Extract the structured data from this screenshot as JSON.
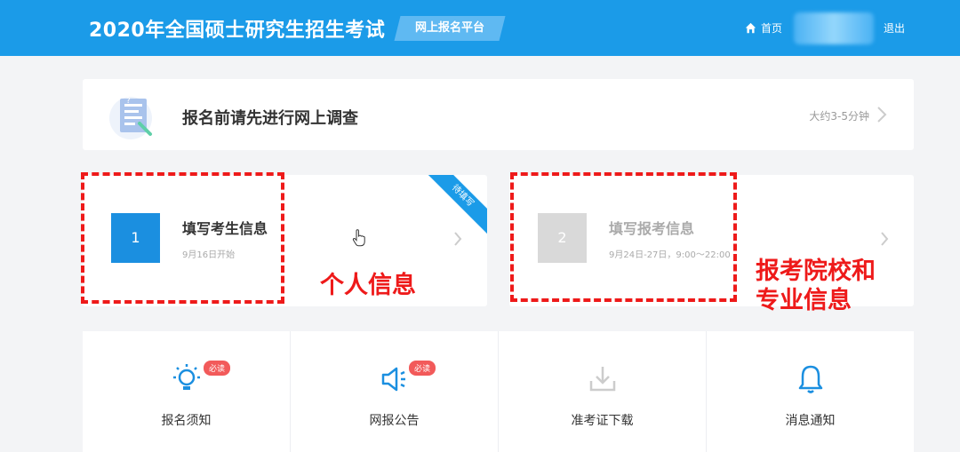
{
  "header": {
    "title": "2020年全国硕士研究生招生考试",
    "platform": "网上报名平台",
    "home": "首页",
    "logout": "退出"
  },
  "survey": {
    "title": "报名前请先进行网上调查",
    "time": "大约3-5分钟"
  },
  "steps": [
    {
      "number": "1",
      "title": "填写考生信息",
      "date": "9月16日开始",
      "ribbon": "待填写"
    },
    {
      "number": "2",
      "title": "填写报考信息",
      "date": "9月24日-27日，9:00～22:00"
    }
  ],
  "annotations": {
    "personal": "个人信息",
    "school_line1": "报考院校和",
    "school_line2": "专业信息"
  },
  "tiles": [
    {
      "label": "报名须知",
      "badge": "必读",
      "icon": "lightbulb-icon"
    },
    {
      "label": "网报公告",
      "badge": "必读",
      "icon": "megaphone-icon"
    },
    {
      "label": "准考证下载",
      "icon": "download-icon"
    },
    {
      "label": "消息通知",
      "icon": "bell-icon"
    }
  ],
  "colors": {
    "primary": "#1b9be8",
    "annotation_red": "#ee1a1a",
    "badge_red": "#f25a5a",
    "disabled_gray": "#d9d9d9"
  }
}
